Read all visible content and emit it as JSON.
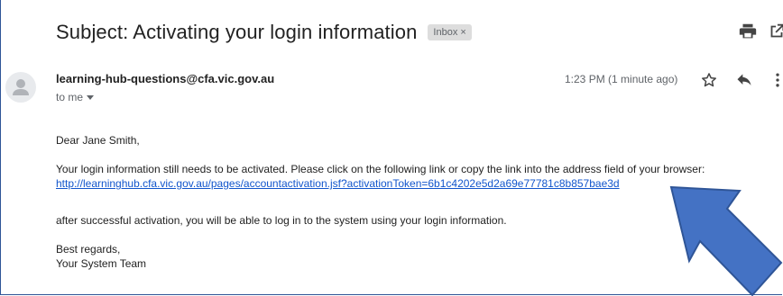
{
  "email": {
    "subject": "Subject: Activating your login information",
    "label_badge": "Inbox",
    "label_badge_close": "×",
    "sender": "learning-hub-questions@cfa.vic.gov.au",
    "recipient": "to me",
    "time": "1:23 PM (1 minute ago)",
    "body": {
      "greeting": "Dear Jane Smith,",
      "line1": "Your login information still needs to be activated. Please click on the following link or copy the link into the address field of your browser:",
      "link": "http://learninghub.cfa.vic.gov.au/pages/accountactivation.jsf?activationToken=6b1c4202e5d2a69e77781c8b857bae3d",
      "line2": "after successful activation, you will be able to log in to the system using your login information.",
      "signoff1": "Best regards,",
      "signoff2": "Your System Team"
    }
  },
  "icons": {
    "print": "print-icon",
    "open_new_window": "open-in-new-window-icon",
    "avatar": "person-icon",
    "star": "star-icon",
    "reply": "reply-icon",
    "more": "more-vertical-icon",
    "annotation": "arrow-annotation"
  },
  "colors": {
    "link": "#1155cc",
    "annotation_arrow": "#4472c4",
    "annotation_arrow_stroke": "#2f5597"
  }
}
